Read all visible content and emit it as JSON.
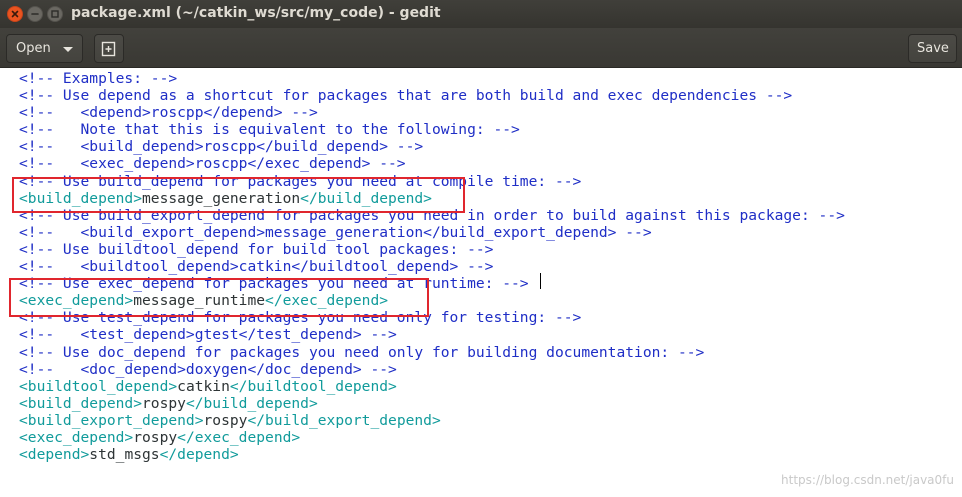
{
  "window": {
    "title": "package.xml (~/catkin_ws/src/my_code) - gedit"
  },
  "header": {
    "open_label": "Open",
    "save_label": "Save"
  },
  "editor": {
    "lines": [
      [
        {
          "c": "comment",
          "t": "<!-- Examples: -->"
        }
      ],
      [
        {
          "c": "comment",
          "t": "<!-- Use depend as a shortcut for packages that are both build and exec dependencies -->"
        }
      ],
      [
        {
          "c": "comment",
          "t": "<!--   <depend>roscpp</depend> -->"
        }
      ],
      [
        {
          "c": "comment",
          "t": "<!--   Note that this is equivalent to the following: -->"
        }
      ],
      [
        {
          "c": "comment",
          "t": "<!--   <build_depend>roscpp</build_depend> -->"
        }
      ],
      [
        {
          "c": "comment",
          "t": "<!--   <exec_depend>roscpp</exec_depend> -->"
        }
      ],
      [
        {
          "c": "comment",
          "t": "<!-- Use build_depend for packages you need at compile time: -->"
        }
      ],
      [
        {
          "c": "tag",
          "t": "<build_depend>"
        },
        {
          "c": "content",
          "t": "message_generation"
        },
        {
          "c": "tag",
          "t": "</build_depend>"
        }
      ],
      [
        {
          "c": "comment",
          "t": "<!-- Use build_export_depend for packages you need in order to build against this package: -->"
        }
      ],
      [
        {
          "c": "comment",
          "t": "<!--   <build_export_depend>message_generation</build_export_depend> -->"
        }
      ],
      [
        {
          "c": "comment",
          "t": "<!-- Use buildtool_depend for build tool packages: -->"
        }
      ],
      [
        {
          "c": "comment",
          "t": "<!--   <buildtool_depend>catkin</buildtool_depend> -->"
        }
      ],
      [
        {
          "c": "comment",
          "t": "<!-- Use exec_depend for packages you need at runtime: -->"
        }
      ],
      [
        {
          "c": "tag",
          "t": "<exec_depend>"
        },
        {
          "c": "content",
          "t": "message_runtime"
        },
        {
          "c": "tag",
          "t": "</exec_depend>"
        }
      ],
      [
        {
          "c": "comment",
          "t": "<!-- Use test_depend for packages you need only for testing: -->"
        }
      ],
      [
        {
          "c": "comment",
          "t": "<!--   <test_depend>gtest</test_depend> -->"
        }
      ],
      [
        {
          "c": "comment",
          "t": "<!-- Use doc_depend for packages you need only for building documentation: -->"
        }
      ],
      [
        {
          "c": "comment",
          "t": "<!--   <doc_depend>doxygen</doc_depend> -->"
        }
      ],
      [
        {
          "c": "tag",
          "t": "<buildtool_depend>"
        },
        {
          "c": "content",
          "t": "catkin"
        },
        {
          "c": "tag",
          "t": "</buildtool_depend>"
        }
      ],
      [
        {
          "c": "tag",
          "t": "<build_depend>"
        },
        {
          "c": "content",
          "t": "rospy"
        },
        {
          "c": "tag",
          "t": "</build_depend>"
        }
      ],
      [
        {
          "c": "tag",
          "t": "<build_export_depend>"
        },
        {
          "c": "content",
          "t": "rospy"
        },
        {
          "c": "tag",
          "t": "</build_export_depend>"
        }
      ],
      [
        {
          "c": "tag",
          "t": "<exec_depend>"
        },
        {
          "c": "content",
          "t": "rospy"
        },
        {
          "c": "tag",
          "t": "</exec_depend>"
        }
      ],
      [
        {
          "c": "tag",
          "t": "<depend>"
        },
        {
          "c": "content",
          "t": "std_msgs"
        },
        {
          "c": "tag",
          "t": "</depend>"
        }
      ]
    ]
  },
  "watermark": {
    "text": "https://blog.csdn.net/java0fu"
  },
  "colors": {
    "comment": "#1f2ec6",
    "tag": "#119b9b",
    "content": "#2e3436",
    "highlight_box": "#e0262e",
    "close_button": "#e95420"
  },
  "icons": [
    "close-icon",
    "minimize-icon",
    "maximize-icon",
    "chevron-down-icon",
    "new-document-icon"
  ]
}
